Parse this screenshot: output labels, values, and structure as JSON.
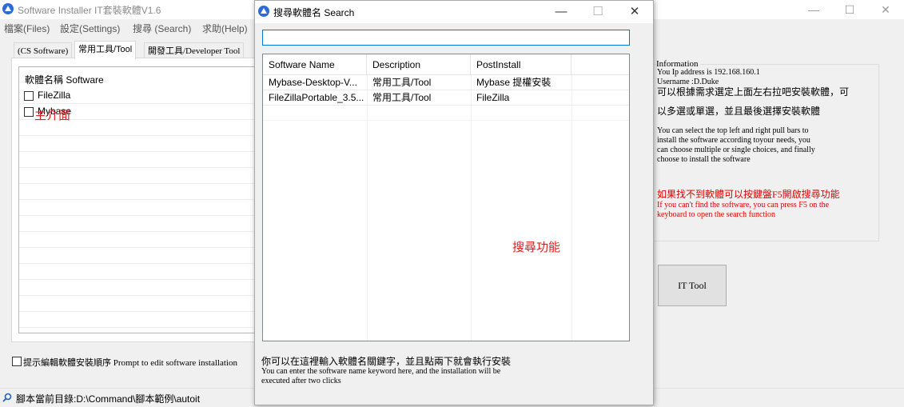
{
  "main_window": {
    "title": "Software Installer IT套裝軟體V1.6",
    "controls": {
      "minimize": "—",
      "maximize": "☐",
      "close": "✕"
    },
    "menu": [
      "檔案(Files)",
      "設定(Settings)",
      "搜尋 (Search)",
      "求助(Help)"
    ],
    "tabs": [
      "(CS Software)",
      "常用工具/Tool",
      "開發工具/Developer Tool"
    ],
    "list": {
      "header": "軟體名稱 Software",
      "items": [
        "FileZilla",
        "Mybase"
      ]
    },
    "annotation": "主介面",
    "prompt_checkbox_label": "提示編輯軟體安裝順序  Prompt to edit software installation",
    "status_text": "腳本當前目錄:D:\\Command\\腳本範例\\autoit"
  },
  "info_panel": {
    "title": "Information",
    "ip": "You Ip address is  192.168.160.1",
    "username": "Username :D.Duke",
    "zh_line1": "可以根據需求選定上面左右拉吧安裝軟體，可",
    "zh_line2": "以多選或單選，並且最後選擇安裝軟體",
    "en_line1": "You can select the top left and right pull bars to",
    "en_line2": "install the software according toyour needs, you",
    "en_line3": "can choose multiple or single choices, and finally",
    "en_line4": "choose to install the software",
    "red_zh": "如果找不到軟體可以按鍵盤F5開啟搜尋功能",
    "red_en1": "If you can't find the software, you can press F5 on the",
    "red_en2": "keyboard to open the search function",
    "button": "IT Tool"
  },
  "search_dialog": {
    "title": "搜尋軟體名 Search",
    "controls": {
      "minimize": "—",
      "maximize": "☐",
      "close": "✕"
    },
    "input_value": "",
    "columns": [
      "Software Name",
      "Description",
      "PostInstall"
    ],
    "rows": [
      [
        "Mybase-Desktop-V...",
        "常用工具/Tool",
        "Mybase 提權安裝"
      ],
      [
        "FileZillaPortable_3.5...",
        "常用工具/Tool",
        "FileZilla"
      ]
    ],
    "annotation": "搜尋功能",
    "hint_zh": "你可以在這裡輸入軟體名關鍵字，並且點兩下就會執行安裝",
    "hint_en1": "You can enter the software name keyword here, and the installation will be",
    "hint_en2": "executed after two clicks"
  }
}
